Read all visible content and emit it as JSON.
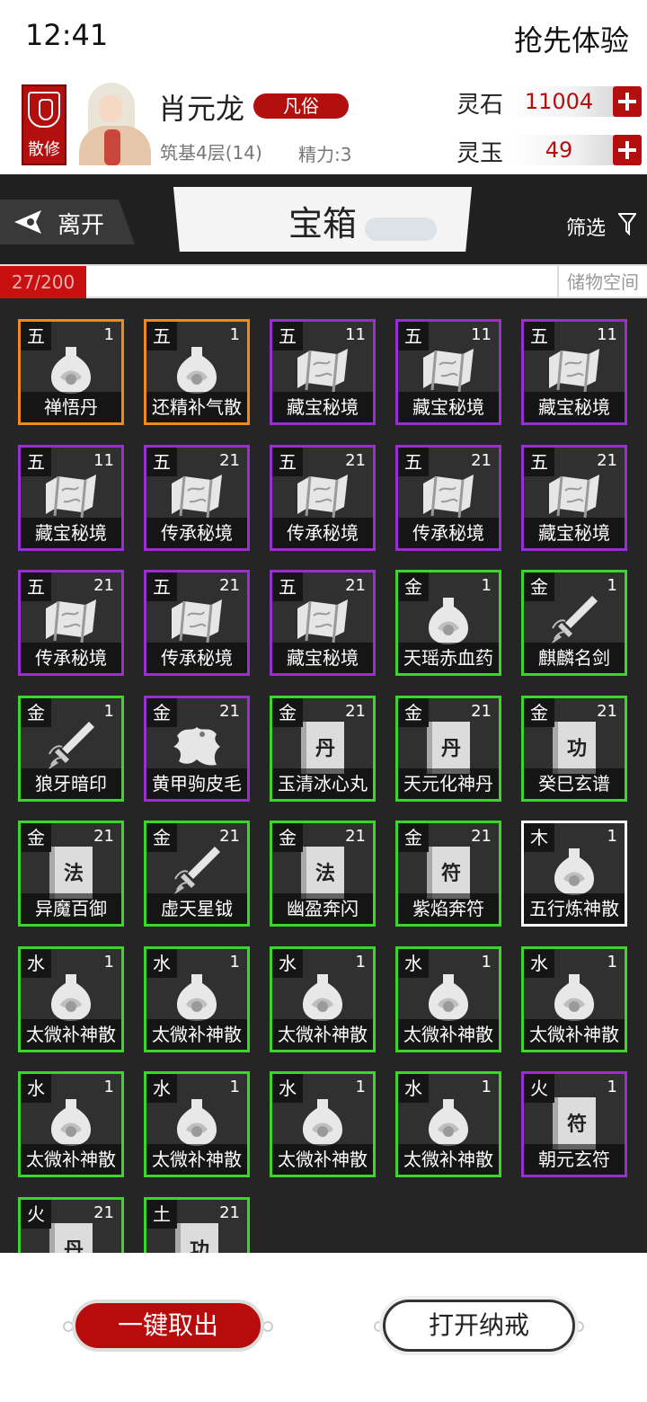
{
  "status_bar": {
    "time": "12:41",
    "right_text": "抢先体验"
  },
  "player": {
    "sect": "散修",
    "name": "肖元龙",
    "realm_tag": "凡俗",
    "realm_level": "筑基4层(14)",
    "energy": "精力:3"
  },
  "currency": [
    {
      "label": "灵石",
      "value": "11004"
    },
    {
      "label": "灵玉",
      "value": "49"
    }
  ],
  "header": {
    "leave_label": "离开",
    "title": "宝箱",
    "filter_label": "筛选"
  },
  "storage": {
    "count": "27/200",
    "label": "储物空间"
  },
  "colors": {
    "orange": "#f08a1c",
    "purple": "#9a2fd0",
    "green": "#3bd52b",
    "white": "#ffffff",
    "accent_red": "#b40f0f"
  },
  "items": [
    {
      "element": "五",
      "count": "1",
      "name": "禅悟丹",
      "rarity": "orange",
      "icon": "vase-icon"
    },
    {
      "element": "五",
      "count": "1",
      "name": "还精补气散",
      "rarity": "orange",
      "icon": "vase-icon"
    },
    {
      "element": "五",
      "count": "11",
      "name": "藏宝秘境",
      "rarity": "purple",
      "icon": "scroll-map-icon"
    },
    {
      "element": "五",
      "count": "11",
      "name": "藏宝秘境",
      "rarity": "purple",
      "icon": "scroll-map-icon"
    },
    {
      "element": "五",
      "count": "11",
      "name": "藏宝秘境",
      "rarity": "purple",
      "icon": "scroll-map-icon"
    },
    {
      "element": "五",
      "count": "11",
      "name": "藏宝秘境",
      "rarity": "purple",
      "icon": "scroll-map-icon"
    },
    {
      "element": "五",
      "count": "21",
      "name": "传承秘境",
      "rarity": "purple",
      "icon": "scroll-map-icon"
    },
    {
      "element": "五",
      "count": "21",
      "name": "传承秘境",
      "rarity": "purple",
      "icon": "scroll-map-icon"
    },
    {
      "element": "五",
      "count": "21",
      "name": "传承秘境",
      "rarity": "purple",
      "icon": "scroll-map-icon"
    },
    {
      "element": "五",
      "count": "21",
      "name": "藏宝秘境",
      "rarity": "purple",
      "icon": "scroll-map-icon"
    },
    {
      "element": "五",
      "count": "21",
      "name": "传承秘境",
      "rarity": "purple",
      "icon": "scroll-map-icon"
    },
    {
      "element": "五",
      "count": "21",
      "name": "传承秘境",
      "rarity": "purple",
      "icon": "scroll-map-icon"
    },
    {
      "element": "五",
      "count": "21",
      "name": "藏宝秘境",
      "rarity": "purple",
      "icon": "scroll-map-icon"
    },
    {
      "element": "金",
      "count": "1",
      "name": "天瑶赤血药",
      "rarity": "green",
      "icon": "vase-icon"
    },
    {
      "element": "金",
      "count": "1",
      "name": "麒麟名剑",
      "rarity": "green",
      "icon": "sword-icon"
    },
    {
      "element": "金",
      "count": "1",
      "name": "狼牙暗印",
      "rarity": "green",
      "icon": "sword-icon"
    },
    {
      "element": "金",
      "count": "21",
      "name": "黄甲驹皮毛",
      "rarity": "purple",
      "icon": "pelt-icon"
    },
    {
      "element": "金",
      "count": "21",
      "name": "玉清冰心丸",
      "rarity": "green",
      "icon": "book-icon",
      "glyph": "丹"
    },
    {
      "element": "金",
      "count": "21",
      "name": "天元化神丹",
      "rarity": "green",
      "icon": "book-icon",
      "glyph": "丹"
    },
    {
      "element": "金",
      "count": "21",
      "name": "癸巳玄谱",
      "rarity": "green",
      "icon": "book-icon",
      "glyph": "功"
    },
    {
      "element": "金",
      "count": "21",
      "name": "异魔百御",
      "rarity": "green",
      "icon": "book-icon",
      "glyph": "法"
    },
    {
      "element": "金",
      "count": "21",
      "name": "虚天星钺",
      "rarity": "green",
      "icon": "sword-icon"
    },
    {
      "element": "金",
      "count": "21",
      "name": "幽盈奔闪",
      "rarity": "green",
      "icon": "book-icon",
      "glyph": "法"
    },
    {
      "element": "金",
      "count": "21",
      "name": "紫焰奔符",
      "rarity": "green",
      "icon": "book-icon",
      "glyph": "符"
    },
    {
      "element": "木",
      "count": "1",
      "name": "五行炼神散",
      "rarity": "white",
      "icon": "vase-icon"
    },
    {
      "element": "水",
      "count": "1",
      "name": "太微补神散",
      "rarity": "green",
      "icon": "vase-icon"
    },
    {
      "element": "水",
      "count": "1",
      "name": "太微补神散",
      "rarity": "green",
      "icon": "vase-icon"
    },
    {
      "element": "水",
      "count": "1",
      "name": "太微补神散",
      "rarity": "green",
      "icon": "vase-icon"
    },
    {
      "element": "水",
      "count": "1",
      "name": "太微补神散",
      "rarity": "green",
      "icon": "vase-icon"
    },
    {
      "element": "水",
      "count": "1",
      "name": "太微补神散",
      "rarity": "green",
      "icon": "vase-icon"
    },
    {
      "element": "水",
      "count": "1",
      "name": "太微补神散",
      "rarity": "green",
      "icon": "vase-icon"
    },
    {
      "element": "水",
      "count": "1",
      "name": "太微补神散",
      "rarity": "green",
      "icon": "vase-icon"
    },
    {
      "element": "水",
      "count": "1",
      "name": "太微补神散",
      "rarity": "green",
      "icon": "vase-icon"
    },
    {
      "element": "水",
      "count": "1",
      "name": "太微补神散",
      "rarity": "green",
      "icon": "vase-icon"
    },
    {
      "element": "火",
      "count": "1",
      "name": "朝元玄符",
      "rarity": "purple",
      "icon": "book-icon",
      "glyph": "符"
    },
    {
      "element": "火",
      "count": "21",
      "name": "",
      "rarity": "green",
      "icon": "book-icon",
      "glyph": "丹"
    },
    {
      "element": "土",
      "count": "21",
      "name": "",
      "rarity": "green",
      "icon": "book-icon",
      "glyph": "功"
    }
  ],
  "actions": {
    "take_all": "一键取出",
    "open_ring": "打开纳戒"
  }
}
